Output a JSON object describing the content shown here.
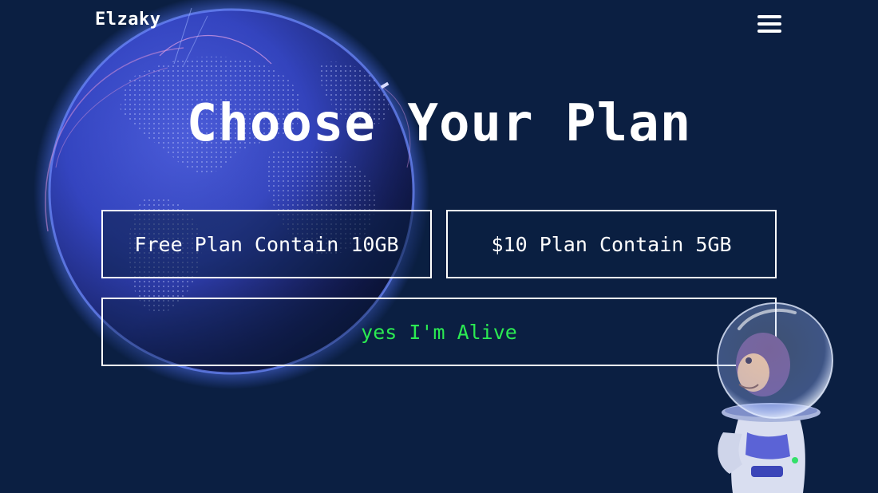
{
  "header": {
    "brand": "Elzaky",
    "menu_icon": "hamburger-menu-icon"
  },
  "main": {
    "title": "Choose Your Plan",
    "plans": [
      {
        "label": "Free Plan Contain 10GB"
      },
      {
        "label": "$10 Plan Contain 5GB"
      }
    ],
    "status": {
      "text": "yes I'm Alive",
      "color": "#2bea52"
    }
  },
  "theme": {
    "background": "#0b1f42",
    "text": "#ffffff",
    "globe_glow": "#4a6cff"
  },
  "decor": {
    "globe": "earth-globe-illustration",
    "mascot": "astronaut-monkey-illustration"
  }
}
